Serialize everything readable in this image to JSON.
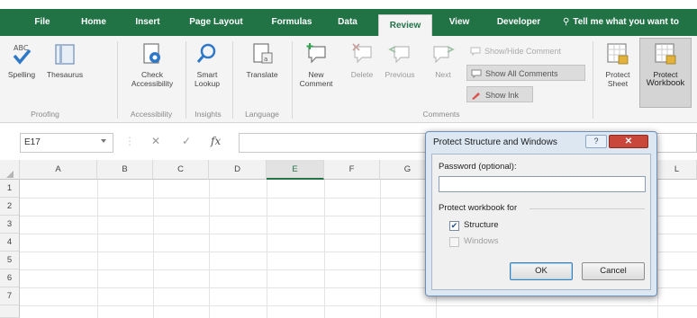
{
  "ribbon_tabs": [
    {
      "label": "File"
    },
    {
      "label": "Home"
    },
    {
      "label": "Insert"
    },
    {
      "label": "Page Layout"
    },
    {
      "label": "Formulas"
    },
    {
      "label": "Data"
    },
    {
      "label": "Review",
      "active": true
    },
    {
      "label": "View"
    },
    {
      "label": "Developer"
    }
  ],
  "tell_me": {
    "icon": "lightbulb-icon",
    "label": "Tell me what you want to"
  },
  "ribbon": {
    "proofing": {
      "spelling_label": "Spelling",
      "thesaurus_label": "Thesaurus",
      "group_label": "Proofing"
    },
    "accessibility": {
      "check_line1": "Check",
      "check_line2": "Accessibility",
      "group_label": "Accessibility"
    },
    "insights": {
      "smart_line1": "Smart",
      "smart_line2": "Lookup",
      "group_label": "Insights"
    },
    "language": {
      "translate_label": "Translate",
      "group_label": "Language"
    },
    "comments": {
      "new_line1": "New",
      "new_line2": "Comment",
      "delete_label": "Delete",
      "previous_label": "Previous",
      "next_label": "Next",
      "show_hide_label": "Show/Hide Comment",
      "show_all_label": "Show All Comments",
      "show_ink_label": "Show Ink",
      "group_label": "Comments"
    },
    "protect": {
      "sheet_line1": "Protect",
      "sheet_line2": "Sheet",
      "workbook_line1": "Protect",
      "workbook_line2": "Workbook"
    }
  },
  "formula_bar": {
    "name_box": "E17",
    "cancel_symbol": "✕",
    "enter_symbol": "✓",
    "fx_symbol": "fx",
    "value": ""
  },
  "grid": {
    "columns": [
      "A",
      "B",
      "C",
      "D",
      "E",
      "F",
      "G",
      "L"
    ],
    "selected_column": "E",
    "rows": [
      "1",
      "2",
      "3",
      "4",
      "5",
      "6",
      "7"
    ]
  },
  "dialog": {
    "title": "Protect Structure and Windows",
    "help_symbol": "?",
    "close_symbol": "✕",
    "password_label": "Password (optional):",
    "password_value": "",
    "protect_for_label": "Protect workbook for",
    "structure_label": "Structure",
    "structure_checked": true,
    "windows_label": "Windows",
    "windows_checked": false,
    "ok_label": "OK",
    "cancel_label": "Cancel"
  },
  "colors": {
    "excel_green": "#217346",
    "dialog_frame": "#dce7f2",
    "close_red": "#c9463a"
  }
}
